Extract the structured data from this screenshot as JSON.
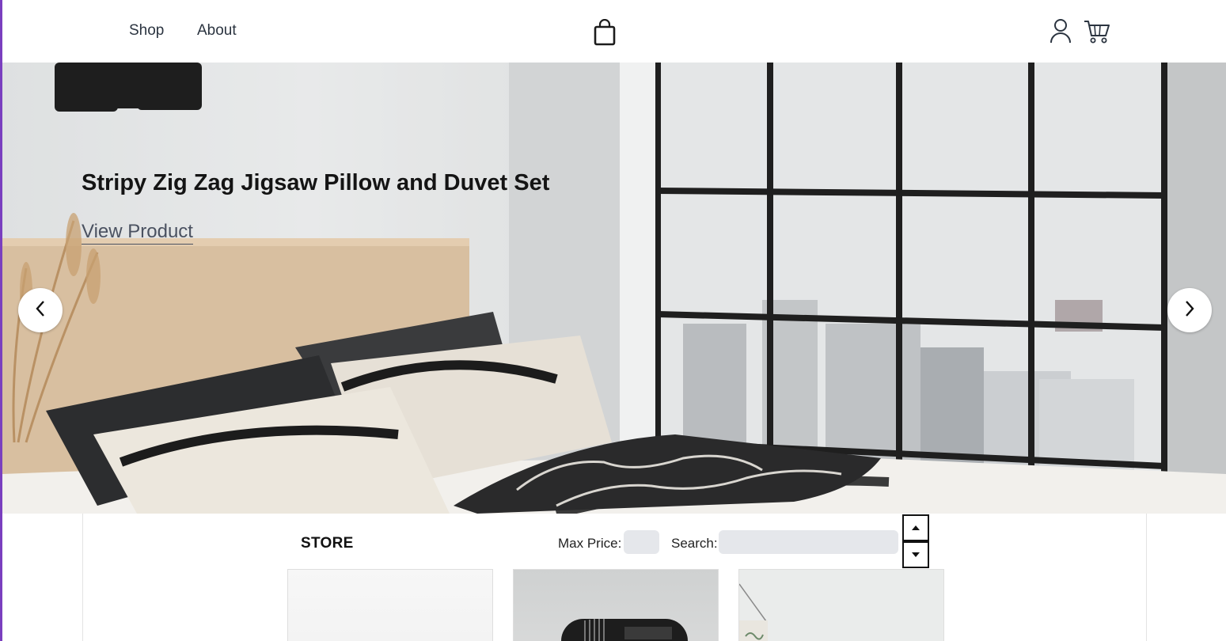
{
  "nav": {
    "links": [
      {
        "label": "Shop"
      },
      {
        "label": "About"
      }
    ],
    "logo_icon": "shopping-bag-icon",
    "account_icon": "user-icon",
    "cart_icon": "cart-icon"
  },
  "hero": {
    "title": "Stripy Zig Zag Jigsaw Pillow and Duvet Set",
    "link_label": "View Product",
    "prev_icon": "chevron-left-icon",
    "next_icon": "chevron-right-icon"
  },
  "store": {
    "title": "STORE",
    "max_price_label": "Max Price:",
    "max_price_value": "",
    "search_label": "Search:",
    "search_value": "",
    "sort_up_icon": "caret-up-icon",
    "sort_down_icon": "caret-down-icon"
  },
  "colors": {
    "accent_edge": "#7a3fbf",
    "input_bg": "#e5e7eb",
    "nav_text": "#2b3440"
  }
}
